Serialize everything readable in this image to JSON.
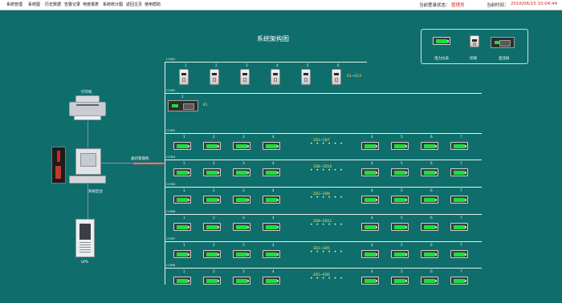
{
  "menu": [
    "系统管理",
    "系统图",
    "历史数据",
    "告警记录",
    "电度报表",
    "系统统计图",
    "返回主页",
    "使用帮助"
  ],
  "status": {
    "login_label": "当前登录状态：",
    "login_value": "管理员",
    "time_label": "当前时间：",
    "time_value": "2016/06/15  10:04:44"
  },
  "title": "系统架构图",
  "legend": {
    "meter": "电力仪表",
    "relay": "综保",
    "dc": "直流屏"
  },
  "workstation": {
    "printer_label": "打印机",
    "host_label": "系统后台",
    "ups_label": "UPS",
    "gateway_label": "通讯管理机"
  },
  "buses": [
    {
      "label": "COM1",
      "kind": "relay",
      "range": "G1~G13",
      "nums": [
        "1",
        "2",
        "3",
        "4",
        "5",
        "6"
      ]
    },
    {
      "label": "COM2",
      "kind": "dc",
      "range": "K1",
      "nums": [
        "1"
      ]
    },
    {
      "label": "COM3",
      "kind": "meter",
      "range": "1D1~1D7",
      "nums": [
        "1",
        "2",
        "3",
        "4",
        "5",
        "6",
        "7"
      ]
    },
    {
      "label": "COM4",
      "kind": "meter",
      "range": "1D8~1D16",
      "nums": [
        "1",
        "2",
        "3",
        "4",
        "5",
        "6",
        "7"
      ]
    },
    {
      "label": "COM5",
      "kind": "meter",
      "range": "2D1~2D8",
      "nums": [
        "1",
        "2",
        "3",
        "4",
        "5",
        "6",
        "7"
      ]
    },
    {
      "label": "COM6",
      "kind": "meter",
      "range": "2D9~2D11",
      "nums": [
        "1",
        "2",
        "3",
        "4",
        "5",
        "6",
        "7"
      ]
    },
    {
      "label": "COM7",
      "kind": "meter",
      "range": "3D1~3D5",
      "nums": [
        "1",
        "2",
        "3",
        "4",
        "5",
        "6",
        "7"
      ]
    },
    {
      "label": "COM8",
      "kind": "meter",
      "range": "4D1~4D6",
      "nums": [
        "1",
        "2",
        "3",
        "4",
        "5",
        "6",
        "7"
      ]
    }
  ],
  "dots": "• • • • • •",
  "colors": {
    "background": "#0f6e6b",
    "screen": "#19e03e",
    "range_text": "#ffe066",
    "alert": "#dd2222"
  }
}
